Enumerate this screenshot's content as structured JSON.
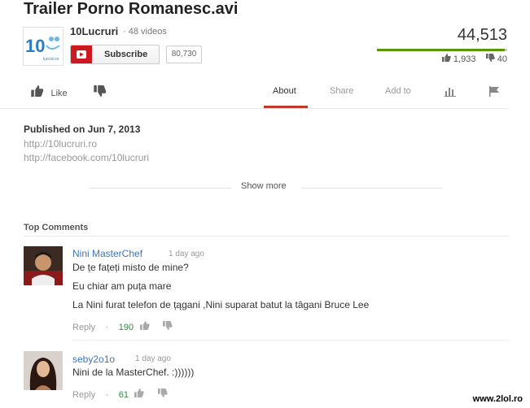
{
  "video": {
    "title": "Trailer Porno Romanesc.avi"
  },
  "channel": {
    "name": "10Lucruri",
    "videos_label": "· 48 videos",
    "subscribe_label": "Subscribe",
    "subscriber_count": "80,730",
    "logo_text": "10",
    "logo_sub": "lucruri.ro"
  },
  "stats": {
    "views": "44,513",
    "likes": "1,933",
    "dislikes": "40",
    "like_ratio": 0.98,
    "bar_fill_color": "#559900"
  },
  "actions": {
    "like_label": "Like"
  },
  "tabs": [
    {
      "label": "About",
      "active": true
    },
    {
      "label": "Share",
      "active": false
    },
    {
      "label": "Add to",
      "active": false
    }
  ],
  "about": {
    "published": "Published on Jun 7, 2013",
    "links": [
      "http://10lucruri.ro",
      "http://facebook.com/10lucruri"
    ],
    "show_more": "Show more"
  },
  "comments_section": {
    "heading": "Top Comments",
    "comments": [
      {
        "author": "Nini MasterChef",
        "time": "1 day ago",
        "lines": [
          "De țe fațeți misto de mine?",
          "Eu chiar am puța mare",
          "La Nini furat telefon de țągani ,Nini suparat batut la tâgani Bruce Lee"
        ],
        "reply_label": "Reply",
        "likes": "190"
      },
      {
        "author": "seby2o1o",
        "time": "1 day ago",
        "lines": [
          "Nini de la MasterChef. :))))))"
        ],
        "reply_label": "Reply",
        "likes": "61"
      }
    ]
  },
  "watermark": "www.2lol.ro",
  "colors": {
    "accent_red": "#cc181e",
    "link_blue": "#3f76b5",
    "like_green": "#2d8c3c"
  }
}
